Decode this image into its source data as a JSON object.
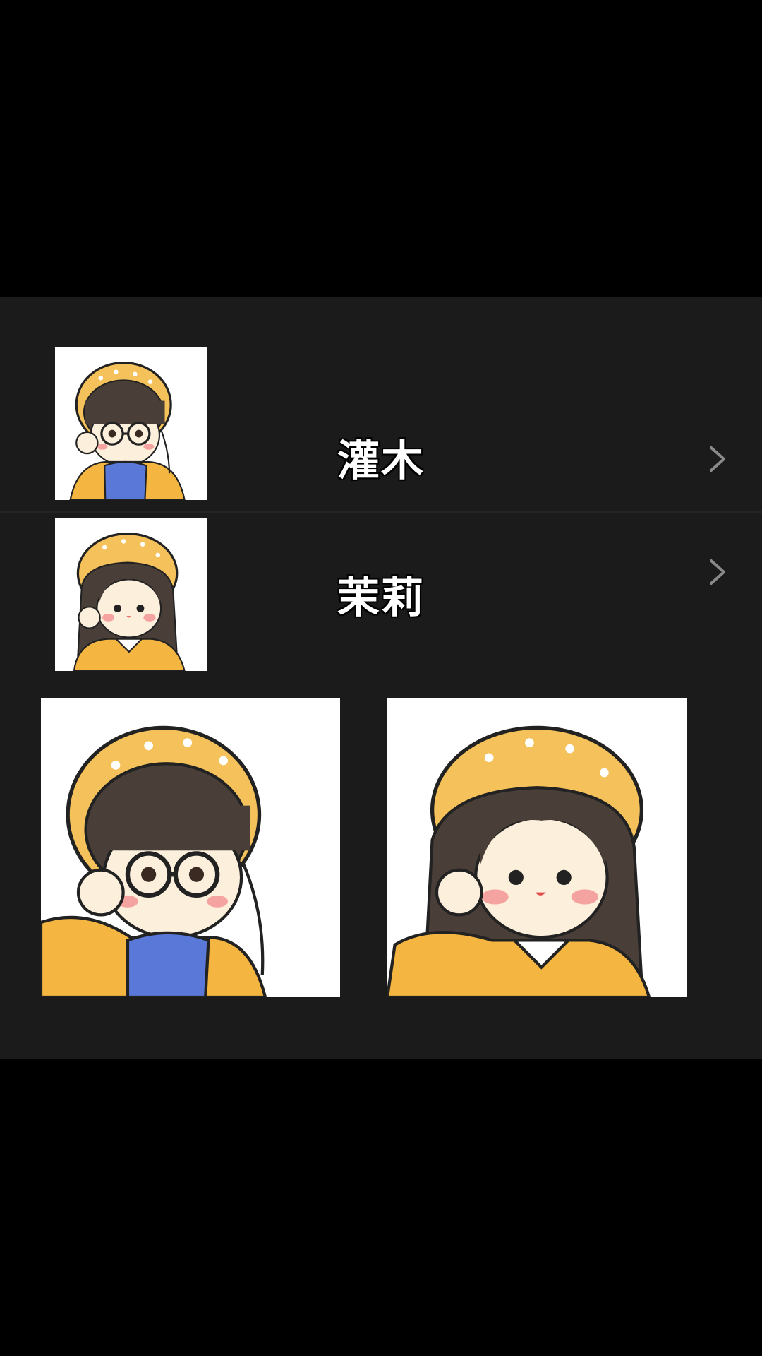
{
  "contacts": [
    {
      "name": "灌木",
      "avatar_icon": "boy-avatar-icon"
    },
    {
      "name": "茉莉",
      "avatar_icon": "girl-avatar-icon"
    }
  ],
  "gallery": [
    {
      "icon": "boy-avatar-icon"
    },
    {
      "icon": "girl-avatar-icon"
    }
  ],
  "colors": {
    "card_background": "#1b1b1b",
    "page_background": "#000000",
    "label": "#ffffff",
    "chevron": "#8a8a8a",
    "hat_yellow": "#f4c15a",
    "hair_brown": "#4a3f38"
  }
}
